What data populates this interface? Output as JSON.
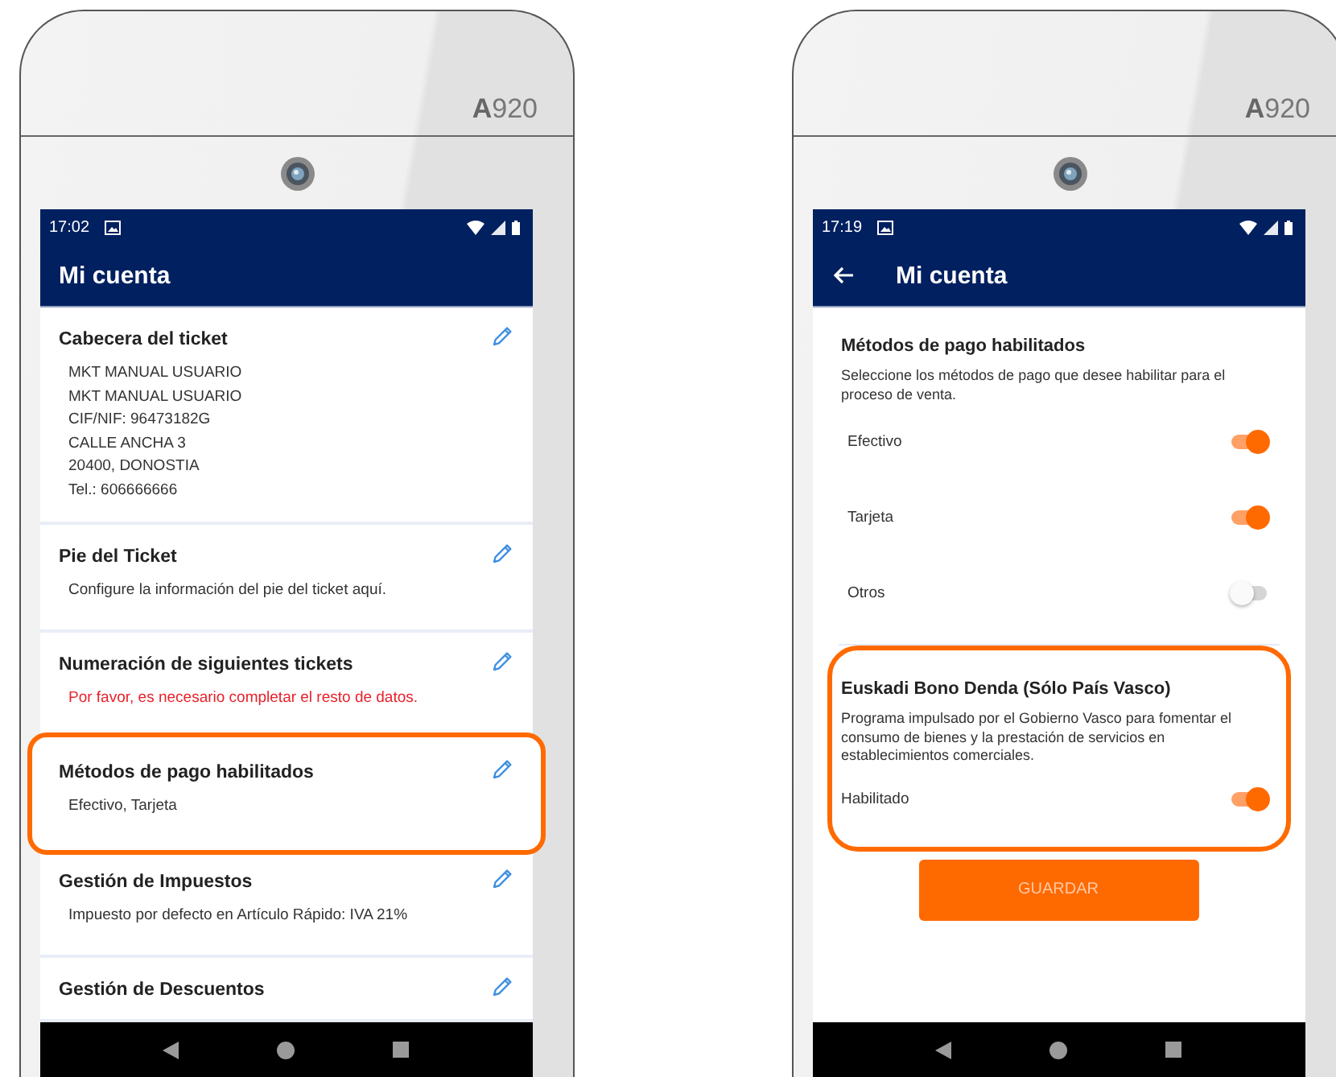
{
  "devices": [
    {
      "model": "**A**920",
      "status_bar": {
        "time": "17:02"
      },
      "app_bar": {
        "title": "Mi cuenta",
        "back_button": false
      },
      "screen": {
        "kind": "list",
        "items": [
          {
            "title": "Cabecera del ticket",
            "lines": [
              "MKT MANUAL USUARIO",
              "MKT MANUAL USUARIO",
              "CIF/NIF: 96473182G",
              "CALLE ANCHA 3",
              "20400, DONOSTIA",
              "Tel.: 606666666"
            ],
            "warning": false,
            "highlighted": false
          },
          {
            "title": "Pie del Ticket",
            "lines": [
              "Configure la información del pie del ticket aquí."
            ],
            "warning": false,
            "highlighted": false
          },
          {
            "title": "Numeración de siguientes tickets",
            "lines": [
              "Por favor, es necesario completar el resto de datos."
            ],
            "warning": true,
            "highlighted": false
          },
          {
            "title": "Métodos de pago habilitados",
            "lines": [
              "Efectivo, Tarjeta"
            ],
            "warning": false,
            "highlighted": true
          },
          {
            "title": "Gestión de Impuestos",
            "lines": [
              "Impuesto por defecto en Artículo Rápido: IVA 21%"
            ],
            "warning": false,
            "highlighted": false
          },
          {
            "title": "Gestión de Descuentos",
            "highlighted": false
          }
        ]
      }
    },
    {
      "model": "**A**920",
      "status_bar": {
        "time": "17:19"
      },
      "app_bar": {
        "title": "Mi cuenta",
        "back_button": true
      },
      "screen": {
        "kind": "form",
        "sections": [
          {
            "title": "Métodos de pago habilitados",
            "description": "Seleccione los métodos de pago que desee habilitar para el proceso de venta.",
            "highlighted": false,
            "toggles": [
              {
                "label": "Efectivo",
                "on": true
              },
              {
                "label": "Tarjeta",
                "on": true
              },
              {
                "label": "Otros",
                "on": false
              }
            ]
          },
          {
            "title": "Euskadi Bono Denda (Sólo País Vasco)",
            "description": "Programa impulsado por el Gobierno Vasco para fomentar el consumo de bienes y la prestación de servicios en establecimientos comerciales.",
            "highlighted": true,
            "toggles": [
              {
                "label": "Habilitado",
                "on": true
              }
            ]
          }
        ],
        "save_button": "GUARDAR"
      }
    }
  ]
}
